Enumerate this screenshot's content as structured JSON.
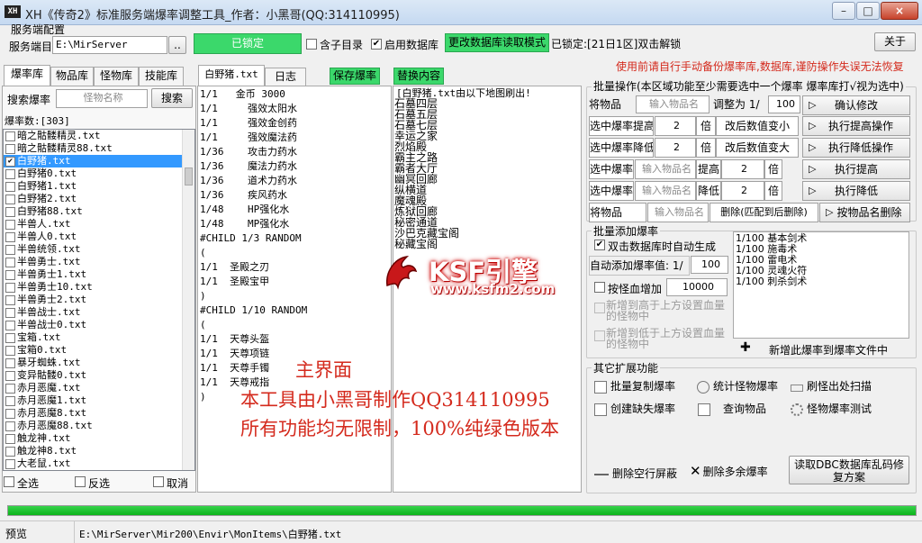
{
  "window": {
    "title": "XH《传奇2》标准服务端爆率调整工具_作者：小黑哥(QQ:314110995)",
    "icon_text": "XH",
    "minimize": "–",
    "maximize": "□",
    "close": "×"
  },
  "server": {
    "group_label": "服务端配置",
    "dir_label": "服务端目",
    "dir_value": "E:\\MirServer",
    "browse_label": "..",
    "locked_btn": "已锁定",
    "subdir_label": "含子目录",
    "use_db_label": "启用数据库",
    "change_db_mode": "更改数据库读取模式",
    "locked_info": "已锁定:[21日1区]双击解锁",
    "about": "关于",
    "backup_warning": "使用前请自行手动备份爆率库,数据库,谨防操作失误无法恢复"
  },
  "left_tabs": [
    "爆率库",
    "物品库",
    "怪物库",
    "技能库"
  ],
  "search": {
    "label": "搜索爆率",
    "placeholder": "怪物名称",
    "button": "搜索",
    "count": "爆率数:[303]"
  },
  "file_list": [
    {
      "name": "暗之骷髅精灵.txt",
      "checked": false,
      "selected": false
    },
    {
      "name": "暗之骷髅精灵88.txt",
      "checked": false,
      "selected": false
    },
    {
      "name": "白野猪.txt",
      "checked": true,
      "selected": true
    },
    {
      "name": "白野猪0.txt",
      "checked": false,
      "selected": false
    },
    {
      "name": "白野猪1.txt",
      "checked": false,
      "selected": false
    },
    {
      "name": "白野猪2.txt",
      "checked": false,
      "selected": false
    },
    {
      "name": "白野猪88.txt",
      "checked": false,
      "selected": false
    },
    {
      "name": "半兽人.txt",
      "checked": false,
      "selected": false
    },
    {
      "name": "半兽人0.txt",
      "checked": false,
      "selected": false
    },
    {
      "name": "半兽统领.txt",
      "checked": false,
      "selected": false
    },
    {
      "name": "半兽勇士.txt",
      "checked": false,
      "selected": false
    },
    {
      "name": "半兽勇士1.txt",
      "checked": false,
      "selected": false
    },
    {
      "name": "半兽勇士10.txt",
      "checked": false,
      "selected": false
    },
    {
      "name": "半兽勇士2.txt",
      "checked": false,
      "selected": false
    },
    {
      "name": "半兽战士.txt",
      "checked": false,
      "selected": false
    },
    {
      "name": "半兽战士0.txt",
      "checked": false,
      "selected": false
    },
    {
      "name": "宝箱.txt",
      "checked": false,
      "selected": false
    },
    {
      "name": "宝箱0.txt",
      "checked": false,
      "selected": false
    },
    {
      "name": "暴牙蜘蛛.txt",
      "checked": false,
      "selected": false
    },
    {
      "name": "变异骷髅0.txt",
      "checked": false,
      "selected": false
    },
    {
      "name": "赤月恶魔.txt",
      "checked": false,
      "selected": false
    },
    {
      "name": "赤月恶魔1.txt",
      "checked": false,
      "selected": false
    },
    {
      "name": "赤月恶魔8.txt",
      "checked": false,
      "selected": false
    },
    {
      "name": "赤月恶魔88.txt",
      "checked": false,
      "selected": false
    },
    {
      "name": "触龙神.txt",
      "checked": false,
      "selected": false
    },
    {
      "name": "触龙神8.txt",
      "checked": false,
      "selected": false
    },
    {
      "name": "大老鼠.txt",
      "checked": false,
      "selected": false
    }
  ],
  "list_footer": {
    "all": "全选",
    "invert": "反选",
    "cancel": "取消"
  },
  "middle_tabs": [
    "白野猪.txt",
    "日志"
  ],
  "save_btn": "保存爆率",
  "replace_btn": "替换内容",
  "drop_content": [
    "1/1   金币 3000",
    "1/1     强效太阳水",
    "1/1     强效金创药",
    "1/1     强效魔法药",
    "1/36    攻击力药水",
    "1/36    魔法力药水",
    "1/36    道术力药水",
    "1/36    疾风药水",
    "1/48    HP强化水",
    "1/48    MP强化水",
    "#CHILD 1/3 RANDOM",
    "(",
    "1/1  圣殿之刃",
    "1/1  圣殿宝甲",
    ")",
    "#CHILD 1/10 RANDOM",
    "(",
    "1/1  天尊头盔",
    "1/1  天尊项链",
    "1/1  天尊手镯",
    "1/1  天尊戒指",
    ")"
  ],
  "map_header": "[白野猪.txt由以下地图刷出!",
  "map_list": [
    "石墓四层",
    "石墓五层",
    "石墓七层",
    "幸运之家",
    "烈焰殿",
    "霸主之路",
    "霸者大厅",
    "幽冥回廊",
    "纵横道",
    "魔魂殿",
    "炼狱回廊",
    "秘密通道",
    "沙巴克藏宝阁",
    "秘藏宝阁"
  ],
  "batch": {
    "title": "批量操作(本区域功能至少需要选中一个爆率 爆率库打√视为选中)",
    "row1_label": "将物品",
    "row1_placeholder": "输入物品名",
    "row1_adjust": "调整为 1/",
    "row1_value": "100",
    "row1_btn": "确认修改",
    "row2_label": "选中爆率提高",
    "row2_value": "2",
    "row2_unit": "倍",
    "row2_mid": "改后数值变小",
    "row2_btn": "执行提高操作",
    "row3_label": "选中爆率降低",
    "row3_value": "2",
    "row3_unit": "倍",
    "row3_mid": "改后数值变大",
    "row3_btn": "执行降低操作",
    "row4_label": "选中爆率",
    "row4_placeholder": "输入物品名",
    "row4_act": "提高",
    "row4_value": "2",
    "row4_unit": "倍",
    "row4_btn": "执行提高",
    "row5_label": "选中爆率",
    "row5_placeholder": "输入物品名",
    "row5_act": "降低",
    "row5_value": "2",
    "row5_unit": "倍",
    "row5_btn": "执行降低",
    "row6_label": "将物品",
    "row6_placeholder": "输入物品名",
    "row6_mid": "删除(匹配到后删除)",
    "row6_btn": "按物品名删除"
  },
  "batch_add": {
    "title": "批量添加爆率",
    "auto_gen": "双击数据库时自动生成",
    "auto_rate_label": "自动添加爆率值: 1/",
    "auto_rate_value": "100",
    "by_hp_label": "按怪血增加",
    "by_hp_value": "10000",
    "add_higher": "新增到高于上方设置血量的怪物中",
    "add_lower": "新增到低于上方设置血量的怪物中",
    "items": [
      "1/100 基本剑术",
      "1/100 施毒术",
      "1/100 雷电术",
      "1/100 灵魂火符",
      "1/100 刺杀剑术"
    ],
    "add_btn": "新增此爆率到爆率文件中"
  },
  "ext": {
    "title": "其它扩展功能",
    "buttons": [
      "批量复制爆率",
      "统计怪物爆率",
      "刷怪出处扫描",
      "创建缺失爆率",
      "查询物品",
      "怪物爆率测试"
    ],
    "remove_blank": "删除空行屏蔽",
    "remove_extra": "删除多余爆率",
    "read_dbc": "读取DBC数据库乱码修复方案"
  },
  "overlay": {
    "l1": "主界面",
    "l2": "本工具由小黑哥制作QQ314110995",
    "l3": "所有功能均无限制，100%纯绿色版本",
    "wm_brand": "KSF引擎",
    "wm_url": "www.ksfm2.com"
  },
  "status": {
    "label": "预览",
    "path": "E:\\MirServer\\Mir200\\Envir\\MonItems\\白野猪.txt",
    "progress": 1.0
  },
  "colors": {
    "green": "#3bd86b",
    "red": "#d42a1d",
    "select": "#3399ff"
  }
}
